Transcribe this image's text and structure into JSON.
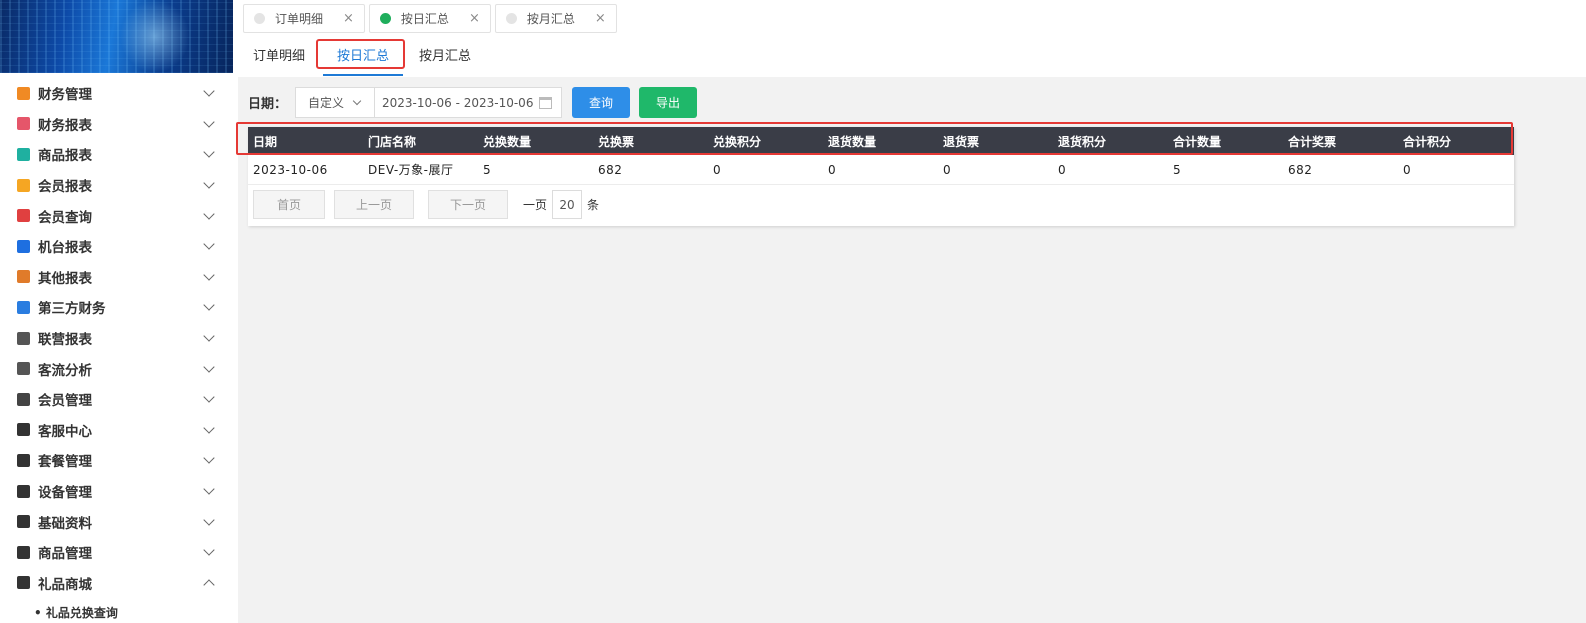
{
  "sidebar": {
    "items": [
      {
        "label": "财务管理",
        "icon": "ledger-icon",
        "color": "#f08a24"
      },
      {
        "label": "财务报表",
        "icon": "report-icon",
        "color": "#e5566a"
      },
      {
        "label": "商品报表",
        "icon": "goods-report-icon",
        "color": "#1fb0a0"
      },
      {
        "label": "会员报表",
        "icon": "member-report-icon",
        "color": "#f5a623"
      },
      {
        "label": "会员查询",
        "icon": "member-search-icon",
        "color": "#e04040"
      },
      {
        "label": "机台报表",
        "icon": "machine-report-icon",
        "color": "#1e6fe0"
      },
      {
        "label": "其他报表",
        "icon": "layers-icon",
        "color": "#e07b2a"
      },
      {
        "label": "第三方财务",
        "icon": "calculator-icon",
        "color": "#2a7de0"
      },
      {
        "label": "联营报表",
        "icon": "partners-icon",
        "color": "#555555"
      },
      {
        "label": "客流分析",
        "icon": "target-icon",
        "color": "#555555"
      },
      {
        "label": "会员管理",
        "icon": "user-circle-icon",
        "color": "#444444"
      },
      {
        "label": "客服中心",
        "icon": "headset-icon",
        "color": "#333333"
      },
      {
        "label": "套餐管理",
        "icon": "edit-icon",
        "color": "#333333"
      },
      {
        "label": "设备管理",
        "icon": "stethoscope-icon",
        "color": "#333333"
      },
      {
        "label": "基础资料",
        "icon": "document-icon",
        "color": "#333333"
      },
      {
        "label": "商品管理",
        "icon": "swap-icon",
        "color": "#333333"
      },
      {
        "label": "礼品商城",
        "icon": "tag-icon",
        "color": "#333333"
      }
    ],
    "sub_item": "• 礼品兑换查询"
  },
  "page_tabs": [
    {
      "label": "订单明细",
      "active": false
    },
    {
      "label": "按日汇总",
      "active": true
    },
    {
      "label": "按月汇总",
      "active": false
    }
  ],
  "sub_tabs": [
    {
      "label": "订单明细"
    },
    {
      "label": "按日汇总"
    },
    {
      "label": "按月汇总"
    }
  ],
  "filter": {
    "label": "日期：",
    "mode": "自定义",
    "date_range": "2023-10-06 - 2023-10-06",
    "query_label": "查询",
    "export_label": "导出"
  },
  "table": {
    "headers": [
      "日期",
      "门店名称",
      "兑换数量",
      "兑换票",
      "兑换积分",
      "退货数量",
      "退货票",
      "退货积分",
      "合计数量",
      "合计奖票",
      "合计积分"
    ],
    "rows": [
      [
        "2023-10-06",
        "DEV-万象-展厅",
        "5",
        "682",
        "0",
        "0",
        "0",
        "0",
        "5",
        "682",
        "0"
      ]
    ]
  },
  "pager": {
    "first": "首页",
    "prev": "上一页",
    "next": "下一页",
    "per_page_prefix": "一页",
    "per_page": "20",
    "per_page_suffix": "条"
  },
  "colors": {
    "accent": "#1e7ad6",
    "query_button": "#2e8ee8",
    "export_button": "#1fb86a",
    "header_bg": "#3a3d47",
    "highlight": "#e53935"
  }
}
